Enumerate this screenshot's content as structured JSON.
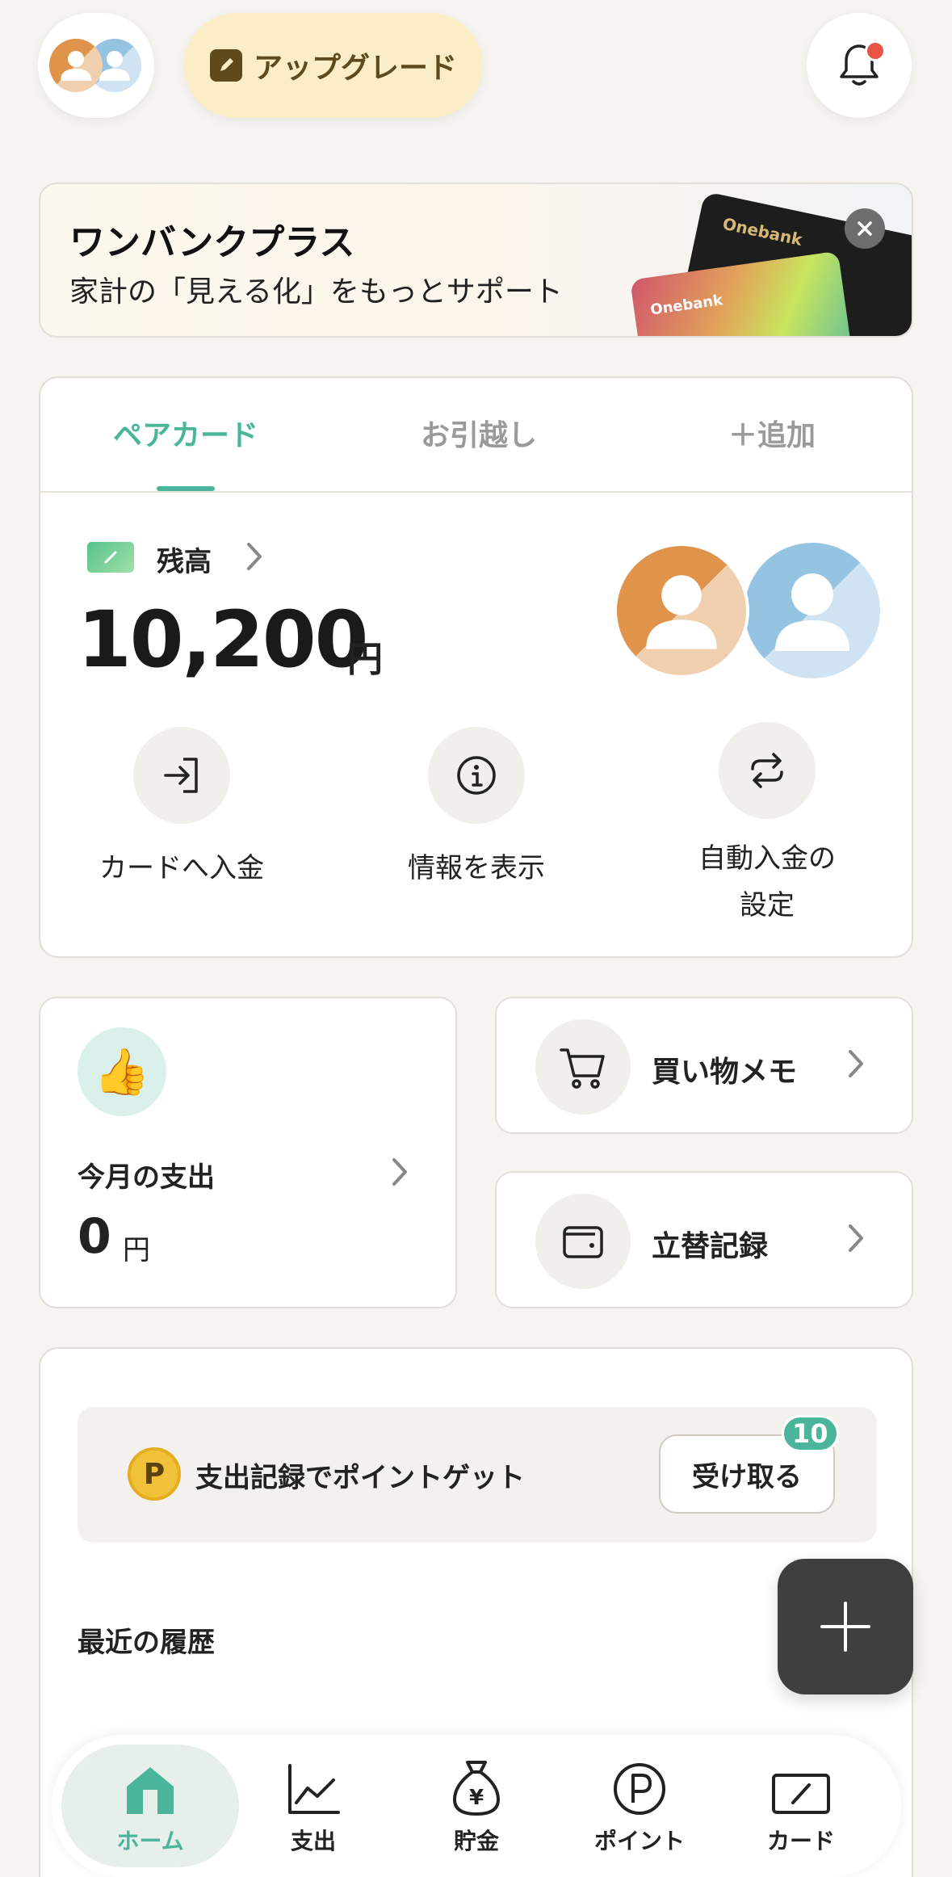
{
  "header": {
    "upgrade_label": "アップグレード"
  },
  "promo": {
    "title": "ワンバンクプラス",
    "subtitle": "家計の「見える化」をもっとサポート",
    "card_brand": "Onebank"
  },
  "pair_card": {
    "tabs": [
      "ペアカード",
      "お引越し",
      "＋追加"
    ],
    "active_tab": 0,
    "balance_label": "残高",
    "balance_amount": "10,200",
    "balance_unit": "円",
    "actions": [
      {
        "label": "カードへ入金",
        "icon": "login-arrow-icon"
      },
      {
        "label": "情報を表示",
        "icon": "info-icon"
      },
      {
        "label_line1": "自動入金の",
        "label_line2": "設定",
        "icon": "repeat-icon"
      }
    ]
  },
  "spending": {
    "label": "今月の支出",
    "value": "0",
    "unit": "円"
  },
  "shortcuts": [
    {
      "label": "買い物メモ",
      "icon": "cart-icon"
    },
    {
      "label": "立替記録",
      "icon": "wallet-icon"
    }
  ],
  "points": {
    "coin": "P",
    "text": "支出記録でポイントゲット",
    "receive_label": "受け取る",
    "badge": "10"
  },
  "recent": {
    "label": "最近の履歴"
  },
  "nav": [
    {
      "label": "ホーム",
      "icon": "home-icon"
    },
    {
      "label": "支出",
      "icon": "chart-line-icon"
    },
    {
      "label": "貯金",
      "icon": "money-bag-icon"
    },
    {
      "label": "ポイント",
      "icon": "point-icon"
    },
    {
      "label": "カード",
      "icon": "card-icon"
    }
  ],
  "colors": {
    "accent": "#4ab59b",
    "upgrade_bg": "#fbedc6",
    "fab": "#3f3f3f",
    "notification_dot": "#e85546"
  }
}
